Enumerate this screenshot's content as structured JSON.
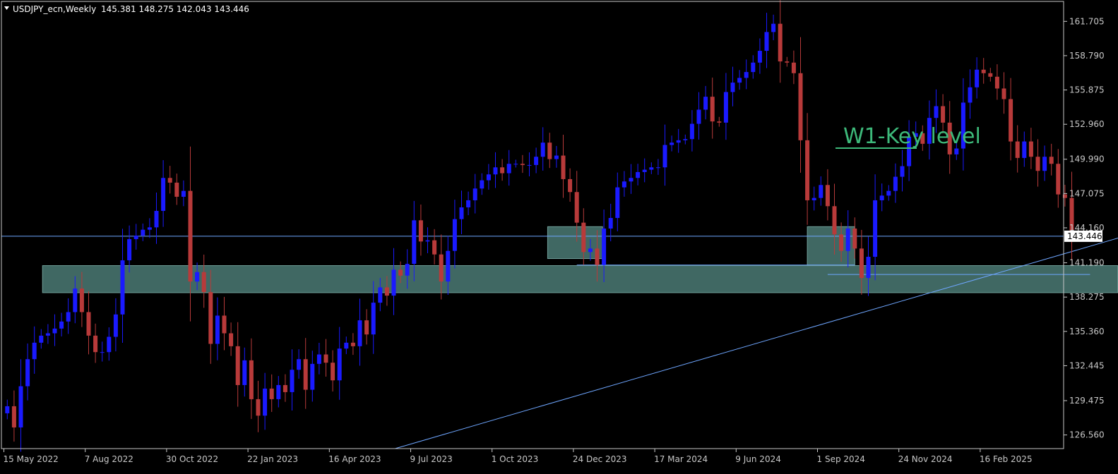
{
  "header": {
    "symbol": "USDJPY_ecn,Weekly",
    "ohlc": "145.381 148.275 142.043 143.446"
  },
  "annotation": {
    "label": "W1-Key level"
  },
  "colors": {
    "background": "#000000",
    "bull": "#1a1aff",
    "bear": "#b83a3a",
    "axis": "#c8c8c8",
    "zone": "#4b7a74",
    "line": "#6ea6ff",
    "annotation": "#3db97a"
  },
  "chart_data": {
    "type": "candlestick",
    "title": "USDJPY_ecn,Weekly",
    "last_price": 143.446,
    "ylim": [
      125.4,
      163.4
    ],
    "y_ticks": [
      161.705,
      158.79,
      155.875,
      152.96,
      149.99,
      147.075,
      144.16,
      141.19,
      138.275,
      135.36,
      132.445,
      129.475,
      126.56
    ],
    "x_labels": [
      {
        "label": "15 May 2022",
        "bar": 0
      },
      {
        "label": "7 Aug 2022",
        "bar": 12
      },
      {
        "label": "30 Oct 2022",
        "bar": 24
      },
      {
        "label": "22 Jan 2023",
        "bar": 36
      },
      {
        "label": "16 Apr 2023",
        "bar": 48
      },
      {
        "label": "9 Jul 2023",
        "bar": 60
      },
      {
        "label": "1 Oct 2023",
        "bar": 72
      },
      {
        "label": "24 Dec 2023",
        "bar": 84
      },
      {
        "label": "17 Mar 2024",
        "bar": 96
      },
      {
        "label": "9 Jun 2024",
        "bar": 108
      },
      {
        "label": "1 Sep 2024",
        "bar": 120
      },
      {
        "label": "24 Nov 2024",
        "bar": 132
      },
      {
        "label": "16 Feb 2025",
        "bar": 144
      }
    ],
    "closes": [
      129.0,
      127.2,
      130.7,
      133.0,
      134.4,
      135.0,
      135.2,
      135.6,
      136.2,
      137.0,
      139.0,
      137.0,
      135.0,
      133.6,
      133.6,
      134.9,
      136.8,
      141.4,
      143.2,
      143.5,
      144.0,
      144.2,
      145.6,
      148.4,
      148.0,
      146.8,
      147.3,
      139.6,
      140.4,
      138.7,
      134.3,
      136.7,
      135.2,
      134.1,
      130.8,
      132.9,
      129.6,
      128.2,
      130.5,
      129.6,
      130.8,
      130.2,
      132.1,
      133.0,
      130.4,
      132.6,
      133.4,
      132.7,
      131.2,
      133.9,
      134.4,
      134.1,
      136.3,
      135.1,
      137.8,
      139.1,
      138.4,
      140.6,
      140.1,
      141.1,
      144.8,
      143.0,
      143.1,
      141.9,
      139.6,
      142.2,
      144.9,
      145.9,
      146.5,
      147.5,
      148.2,
      148.7,
      149.3,
      148.8,
      149.6,
      149.6,
      149.5,
      149.5,
      150.2,
      151.4,
      150.0,
      150.3,
      148.3,
      147.2,
      144.6,
      142.1,
      142.4,
      141.0,
      144.1,
      145.0,
      147.6,
      148.1,
      148.4,
      148.9,
      149.1,
      149.3,
      149.3,
      151.2,
      151.4,
      151.6,
      151.7,
      153.0,
      154.2,
      155.3,
      153.2,
      153.1,
      155.7,
      156.5,
      156.9,
      157.4,
      158.2,
      159.2,
      160.8,
      161.5,
      158.3,
      158.2,
      157.3,
      151.6,
      146.5,
      146.7,
      147.8,
      146.0,
      143.6,
      142.2,
      144.1,
      142.4,
      139.9,
      141.7,
      146.5,
      146.9,
      147.3,
      148.5,
      149.4,
      151.9,
      152.2,
      151.3,
      153.5,
      154.5,
      153.1,
      150.4,
      150.9,
      154.8,
      156.1,
      157.6,
      157.3,
      157.0,
      156.0,
      155.1,
      151.5,
      150.1,
      151.5,
      150.2,
      149.0,
      150.2,
      149.6,
      147.0,
      146.7,
      143.4
    ],
    "zones": [
      {
        "name": "weekly key support zone",
        "bar_from": 5.7,
        "bar_to": 164.3,
        "low": 138.65,
        "high": 140.95
      },
      {
        "name": "left retest box",
        "bar_from": 80.2,
        "bar_to": 88.3,
        "low": 141.55,
        "high": 144.26
      },
      {
        "name": "right retest box",
        "bar_from": 118.5,
        "bar_to": 125.5,
        "low": 140.95,
        "high": 144.26
      }
    ],
    "lines": [
      {
        "name": "last price line",
        "type": "horizontal",
        "y": 143.446
      },
      {
        "name": "swing low line 1",
        "from": [
          84.5,
          141.0
        ],
        "to": [
          125.5,
          141.0
        ]
      },
      {
        "name": "swing low line 2",
        "from": [
          121.5,
          140.2
        ],
        "to": [
          160.2,
          140.2
        ]
      },
      {
        "name": "ascending trendline",
        "from": [
          57.7,
          125.4
        ],
        "to": [
          190.6,
          147.7
        ]
      }
    ]
  }
}
